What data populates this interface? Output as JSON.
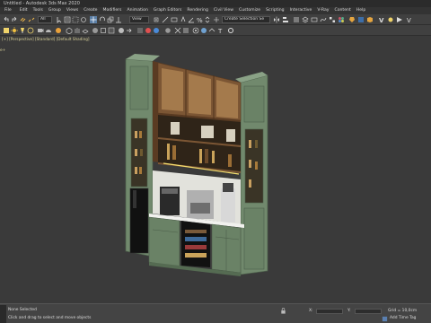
{
  "window": {
    "title": "Untitled - Autodesk 3ds Max 2020"
  },
  "menu": [
    "File",
    "Edit",
    "Tools",
    "Group",
    "Views",
    "Create",
    "Modifiers",
    "Animation",
    "Graph Editors",
    "Rendering",
    "Civil View",
    "Customize",
    "Scripting",
    "Interactive",
    "V-Ray",
    "Content",
    "Help"
  ],
  "toolbar": {
    "selection_filter": "All",
    "coordinate_system": "View",
    "named_selection": "Create Selection Se"
  },
  "viewport": {
    "label": "[+] [Perspective] [Standard] [Default Shading]",
    "side_label": "e+"
  },
  "status": {
    "selection": "None Selected",
    "prompt": "Click and drag to select and move objects",
    "x_label": "X:",
    "y_label": "Y:",
    "grid": "Grid = 10,0cm",
    "add_time_tag": "Add Time Tag"
  },
  "colors": {
    "viewport_bg": "#3a3a3a",
    "cabinet_green": "#6f8a6d",
    "wood": "#6b4a2e",
    "selection_label": "#d9d29a"
  }
}
